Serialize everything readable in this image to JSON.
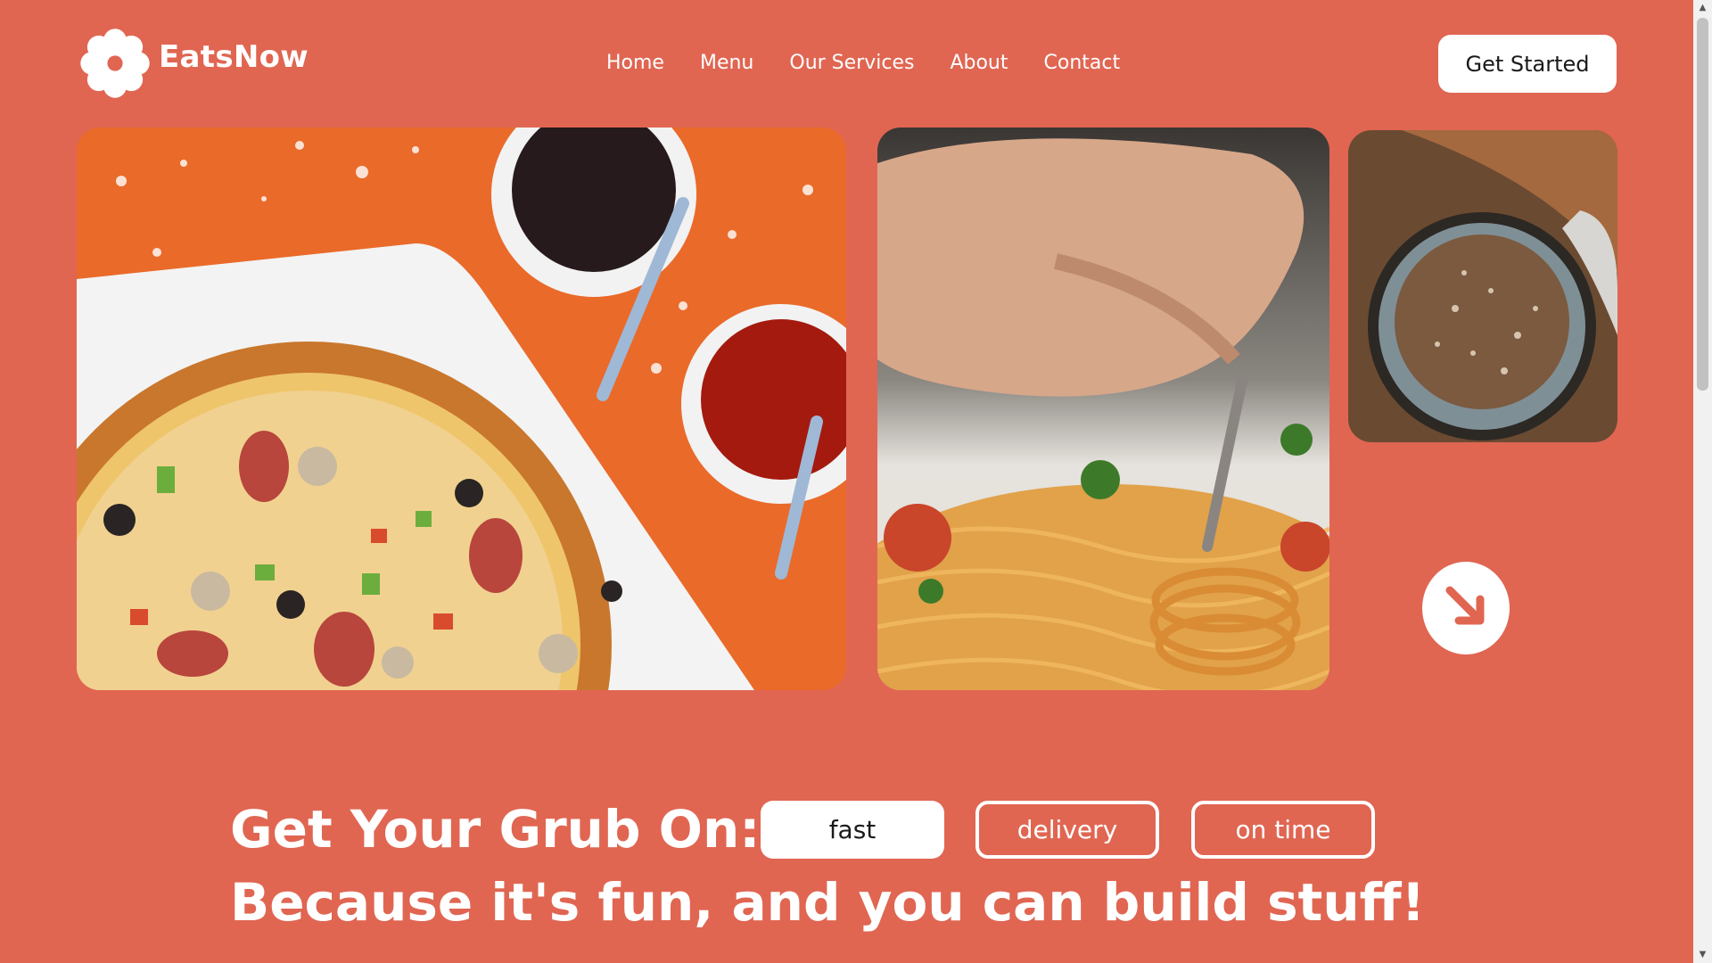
{
  "brand": {
    "name": "EatsNow",
    "logo_icon": "flower-icon"
  },
  "nav": {
    "items": [
      "Home",
      "Menu",
      "Our Services",
      "About",
      "Contact"
    ]
  },
  "header": {
    "cta_label": "Get Started"
  },
  "gallery": {
    "images": [
      "pizza-photo",
      "spaghetti-photo",
      "spice-bowl-photo"
    ],
    "next_icon": "arrow-down-right-icon"
  },
  "hero": {
    "title": "Get Your Grub On:",
    "subtitle": "Because it's fun, and you can build stuff!",
    "pills": [
      "fast",
      "delivery",
      "on time"
    ],
    "selected_pill": "fast"
  },
  "colors": {
    "background": "#e06652",
    "accent_orange": "#ea6a2a",
    "text": "#ffffff"
  }
}
